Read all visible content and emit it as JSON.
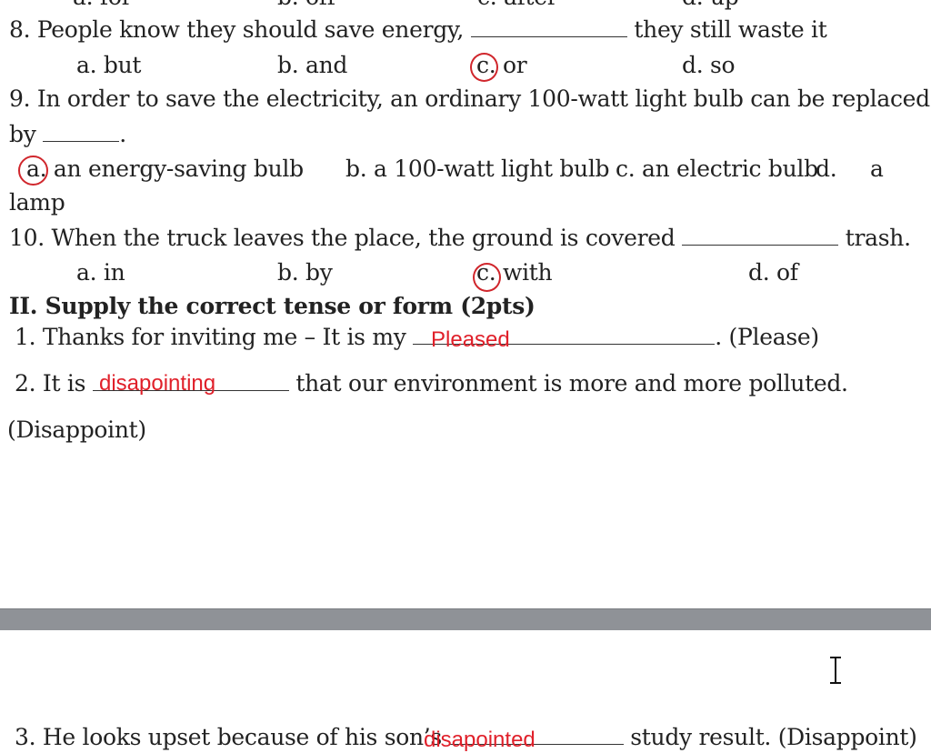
{
  "top_cutoff": {
    "a": "a. for",
    "b": "b. off",
    "c": "c. after",
    "d": "d. up"
  },
  "questions": [
    {
      "prompt_start": "8. People know they should save energy,",
      "prompt_end": "they still waste it",
      "options": {
        "a": "a. but",
        "b": "b. and",
        "c": "c. or",
        "d": "d. so"
      },
      "circled": "c"
    },
    {
      "prompt_line1": "9. In order to save the electricity, an ordinary 100-watt light bulb can be replaced",
      "prompt_line2": "by",
      "options": {
        "a": "a. an energy-saving bulb",
        "b": "b. a 100-watt light bulb",
        "c": "c. an electric bulb",
        "d": "d.",
        "d_text": "a",
        "d_cont": "lamp"
      },
      "circled": "a"
    },
    {
      "prompt_start": "10. When the truck leaves the place, the ground is covered",
      "prompt_end": "trash.",
      "options": {
        "a": "a. in",
        "b": "b. by",
        "c": "c. with",
        "d": "d. of"
      },
      "circled": "c"
    }
  ],
  "section2": {
    "heading": "II. Supply the correct tense or form (2pts)",
    "items": [
      {
        "start": "1. Thanks for inviting me – It is my",
        "end": ". (Please)",
        "answer": "Pleased"
      },
      {
        "start": "2. It is",
        "end": "that our environment is more and more polluted.",
        "cont": "(Disappoint)",
        "answer": "disapointing"
      },
      {
        "start": "3. He looks upset because of his son’s",
        "end": "study result. (Disappoint)",
        "answer": "disapointed"
      }
    ]
  },
  "colors": {
    "annotation": "#e0202a",
    "divider": "#8f9297",
    "text": "#222222"
  }
}
